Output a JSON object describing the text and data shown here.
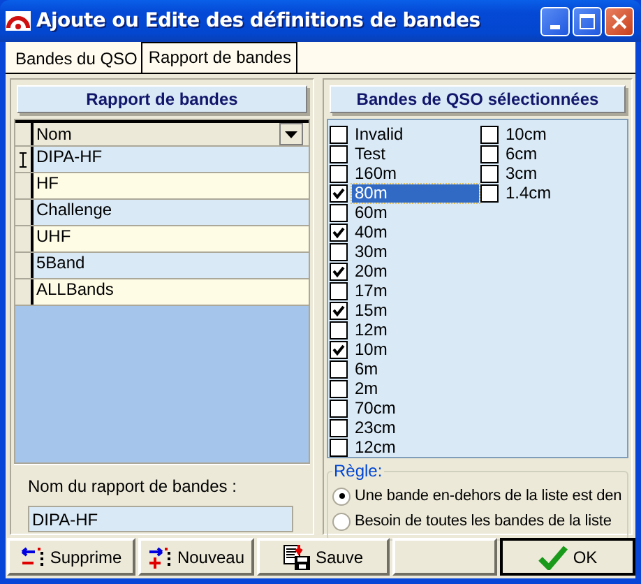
{
  "window": {
    "title": "Ajoute ou Edite des définitions de bandes"
  },
  "tabs": [
    {
      "label": "Bandes du QSO",
      "selected": false
    },
    {
      "label": "Rapport de bandes",
      "selected": true
    }
  ],
  "report": {
    "title": "Rapport de bandes",
    "column": "Nom",
    "rows": [
      {
        "name": "DIPA-HF",
        "selected": true
      },
      {
        "name": "HF",
        "selected": false
      },
      {
        "name": "Challenge",
        "selected": false
      },
      {
        "name": "UHF",
        "selected": false
      },
      {
        "name": "5Band",
        "selected": false
      },
      {
        "name": "ALLBands",
        "selected": false
      }
    ],
    "name_label": "Nom du rapport de bandes :",
    "name_value": "DIPA-HF"
  },
  "bands": {
    "title": "Bandes de QSO sélectionnées",
    "items": [
      {
        "label": "Invalid",
        "checked": false,
        "selected": false
      },
      {
        "label": "Test",
        "checked": false,
        "selected": false
      },
      {
        "label": "160m",
        "checked": false,
        "selected": false
      },
      {
        "label": "80m",
        "checked": true,
        "selected": true
      },
      {
        "label": "60m",
        "checked": false,
        "selected": false
      },
      {
        "label": "40m",
        "checked": true,
        "selected": false
      },
      {
        "label": "30m",
        "checked": false,
        "selected": false
      },
      {
        "label": "20m",
        "checked": true,
        "selected": false
      },
      {
        "label": "17m",
        "checked": false,
        "selected": false
      },
      {
        "label": "15m",
        "checked": true,
        "selected": false
      },
      {
        "label": "12m",
        "checked": false,
        "selected": false
      },
      {
        "label": "10m",
        "checked": true,
        "selected": false
      },
      {
        "label": "6m",
        "checked": false,
        "selected": false
      },
      {
        "label": "2m",
        "checked": false,
        "selected": false
      },
      {
        "label": "70cm",
        "checked": false,
        "selected": false
      },
      {
        "label": "23cm",
        "checked": false,
        "selected": false
      },
      {
        "label": "12cm",
        "checked": false,
        "selected": false
      },
      {
        "label": "10cm",
        "checked": false,
        "selected": false
      },
      {
        "label": "6cm",
        "checked": false,
        "selected": false
      },
      {
        "label": "3cm",
        "checked": false,
        "selected": false
      },
      {
        "label": "1.4cm",
        "checked": false,
        "selected": false
      }
    ]
  },
  "rule": {
    "legend": "Règle:",
    "options": [
      {
        "label": "Une bande en-dehors de la liste est den",
        "selected": true
      },
      {
        "label": "Besoin de toutes les bandes de la liste",
        "selected": false
      }
    ]
  },
  "buttons": [
    {
      "label": "Supprime",
      "kind": "delete"
    },
    {
      "label": "Nouveau",
      "kind": "new"
    },
    {
      "label": "Sauve",
      "kind": "save"
    },
    {
      "label": "OK",
      "kind": "ok"
    }
  ]
}
